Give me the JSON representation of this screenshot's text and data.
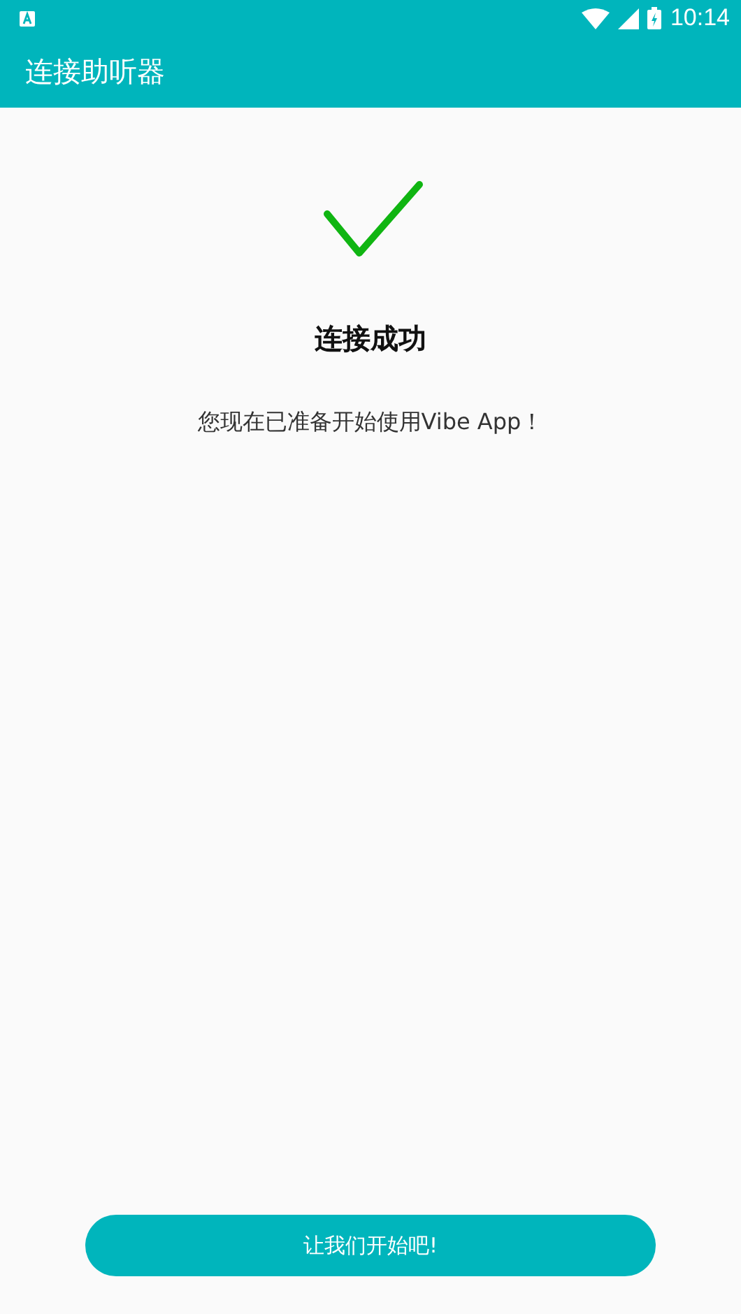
{
  "status_bar": {
    "time": "10:14"
  },
  "app_bar": {
    "title": "连接助听器"
  },
  "result": {
    "title": "连接成功",
    "message": "您现在已准备开始使用Vibe App！"
  },
  "button": {
    "label": "让我们开始吧!"
  }
}
